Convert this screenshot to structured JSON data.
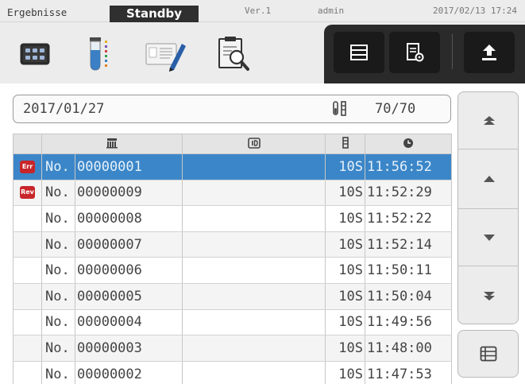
{
  "status_bar": {
    "screen_title": "Ergebnisse",
    "state": "Standby",
    "version": "Ver.1",
    "user": "admin",
    "datetime": "2017/02/13 17:24"
  },
  "toolbar": {
    "tools": [
      {
        "icon": "plate-icon"
      },
      {
        "icon": "test-tube-icon"
      },
      {
        "icon": "edit-report-icon"
      },
      {
        "icon": "search-report-icon"
      }
    ],
    "actions": [
      {
        "icon": "list-view-icon"
      },
      {
        "icon": "report-settings-icon"
      },
      {
        "icon": "upload-icon"
      }
    ]
  },
  "info_bar": {
    "date": "2017/01/27",
    "icon": "tube-rack-icon",
    "count": "70/70"
  },
  "table": {
    "header_icons": [
      "flag-header",
      "sample-number-icon",
      "id-icon",
      "tube-type-icon",
      "clock-icon"
    ],
    "rows": [
      {
        "flag": "Err",
        "prefix": "No.",
        "number": "00000001",
        "id": "",
        "type": "10S",
        "time": "11:56:52",
        "selected": true
      },
      {
        "flag": "Rev",
        "prefix": "No.",
        "number": "00000009",
        "id": "",
        "type": "10S",
        "time": "11:52:29",
        "selected": false
      },
      {
        "flag": "",
        "prefix": "No.",
        "number": "00000008",
        "id": "",
        "type": "10S",
        "time": "11:52:22",
        "selected": false
      },
      {
        "flag": "",
        "prefix": "No.",
        "number": "00000007",
        "id": "",
        "type": "10S",
        "time": "11:52:14",
        "selected": false
      },
      {
        "flag": "",
        "prefix": "No.",
        "number": "00000006",
        "id": "",
        "type": "10S",
        "time": "11:50:11",
        "selected": false
      },
      {
        "flag": "",
        "prefix": "No.",
        "number": "00000005",
        "id": "",
        "type": "10S",
        "time": "11:50:04",
        "selected": false
      },
      {
        "flag": "",
        "prefix": "No.",
        "number": "00000004",
        "id": "",
        "type": "10S",
        "time": "11:49:56",
        "selected": false
      },
      {
        "flag": "",
        "prefix": "No.",
        "number": "00000003",
        "id": "",
        "type": "10S",
        "time": "11:48:00",
        "selected": false
      },
      {
        "flag": "",
        "prefix": "No.",
        "number": "00000002",
        "id": "",
        "type": "10S",
        "time": "11:47:53",
        "selected": false
      }
    ]
  },
  "nav": {
    "buttons": [
      "first-page-icon",
      "page-up-icon",
      "page-down-icon",
      "last-page-icon"
    ],
    "list_button": "list-icon"
  },
  "colors": {
    "selected_row": "#3b86c8",
    "error_flag": "#c8262a",
    "toolbar_dark": "#2a2a2a",
    "state_badge": "#2f2f2f"
  }
}
